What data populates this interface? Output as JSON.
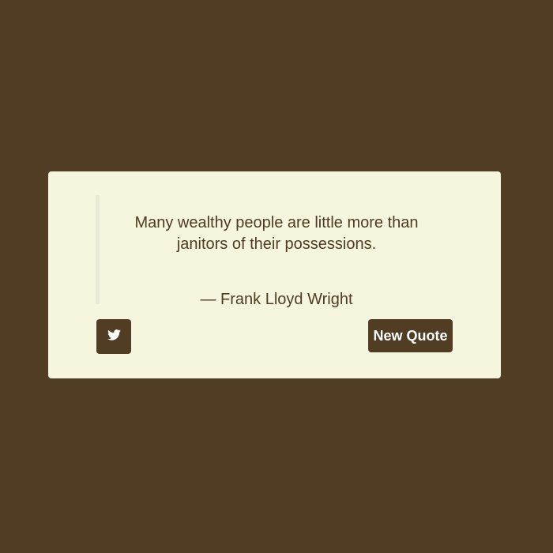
{
  "quote": {
    "text": "Many wealthy people are little more than janitors of their possessions.",
    "author": "— Frank Lloyd Wright"
  },
  "actions": {
    "tweet_icon": "twitter-bird-icon",
    "new_quote_label": "New Quote"
  },
  "colors": {
    "background": "#513d23",
    "card": "#f5f6dd",
    "text": "#4e3b22",
    "button": "#513d23",
    "button_text": "#ffffff",
    "quote_border": "#e9ebd7"
  }
}
